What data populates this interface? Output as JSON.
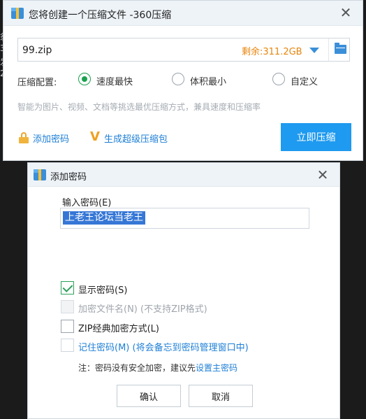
{
  "compress_window": {
    "title": "您将创建一个压缩文件 -360压缩",
    "path_value": "99.zip",
    "free_space": "剩余:311.2GB",
    "config_label": "压缩配置:",
    "options": [
      {
        "label": "速度最快",
        "selected": true
      },
      {
        "label": "体积最小",
        "selected": false
      },
      {
        "label": "自定义",
        "selected": false
      }
    ],
    "hint": "智能为图片、视频、文档等挑选最优压缩方式，兼具速度和压缩率",
    "add_password": "添加密码",
    "super_package": "生成超级压缩包",
    "compress_button": "立即压缩"
  },
  "password_dialog": {
    "title": "添加密码",
    "input_label": "输入密码(E)",
    "password_value": "上老王论坛当老王",
    "checkboxes": [
      {
        "label": "显示密码(S)",
        "checked": true,
        "enabled": true
      },
      {
        "label": "加密文件名(N) (不支持ZIP格式)",
        "checked": false,
        "enabled": false
      },
      {
        "label": "ZIP经典加密方式(L)",
        "checked": false,
        "enabled": true
      },
      {
        "label": "记住密码(M) (将会备忘到密码管理窗口中)",
        "checked": false,
        "enabled": true
      }
    ],
    "note_text": "注：密码没有安全加密，建议先",
    "note_link": "设置主密码",
    "ok_button": "确认",
    "cancel_button": "取消"
  },
  "colors": {
    "accent": "#1e9af0",
    "link": "#1e7fd6",
    "free_space": "#e8850c",
    "selected_radio": "#1aa14e"
  }
}
